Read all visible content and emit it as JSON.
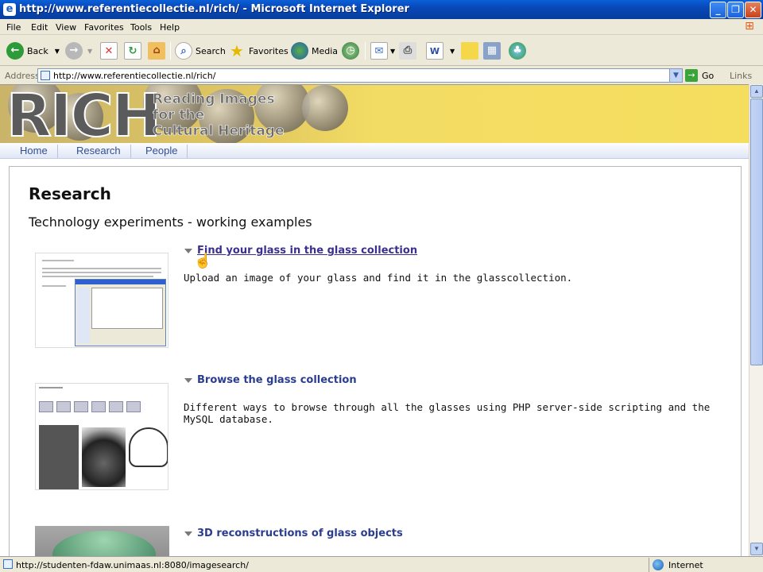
{
  "window": {
    "title": "http://www.referentiecollectie.nl/rich/ - Microsoft Internet Explorer"
  },
  "menu": [
    "File",
    "Edit",
    "View",
    "Favorites",
    "Tools",
    "Help"
  ],
  "toolbar": {
    "back": "Back",
    "search": "Search",
    "favorites": "Favorites",
    "media": "Media"
  },
  "address": {
    "label": "Address",
    "url": "http://www.referentiecollectie.nl/rich/",
    "go": "Go",
    "links": "Links"
  },
  "banner": {
    "logo": "RICH",
    "subtitle_lines": [
      "Reading Images",
      "for the",
      "Cultural Heritage"
    ]
  },
  "nav": [
    "Home",
    "Research",
    "People"
  ],
  "page": {
    "title": "Research",
    "subtitle": "Technology experiments - working examples",
    "items": [
      {
        "title": "Find your glass in the glass collection",
        "description": "Upload an image of your glass and find it in the glasscollection."
      },
      {
        "title": "Browse the glass collection",
        "description": "Different ways to browse through all the glasses using PHP server-side scripting and the MySQL database."
      },
      {
        "title": "3D reconstructions of glass objects",
        "description": ""
      }
    ]
  },
  "status": {
    "text": "http://studenten-fdaw.unimaas.nl:8080/imagesearch/",
    "zone": "Internet"
  },
  "colors": {
    "link": "#2a3d8f",
    "banner": "#f3dc64",
    "titlebar": "#0848b8"
  }
}
